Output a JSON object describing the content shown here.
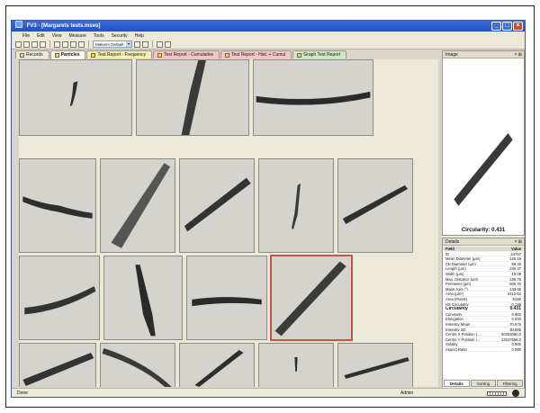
{
  "window": {
    "title": "FV3 - [Margarets tests.mses]",
    "controls": [
      "_",
      "□",
      "×"
    ]
  },
  "menu": [
    "File",
    "Edit",
    "View",
    "Measure",
    "Tools",
    "Security",
    "Help"
  ],
  "toolbar": {
    "profile_value": "Malvern Default",
    "icons": [
      "new-icon",
      "open-icon",
      "save-icon",
      "print-icon",
      "cut-icon",
      "copy-icon",
      "paste-icon",
      "undo-icon",
      "filter-icon",
      "play-icon",
      "back-icon",
      "forward-icon"
    ]
  },
  "tabs": [
    {
      "label": "Records",
      "style": "plain"
    },
    {
      "label": "Particles",
      "style": "active"
    },
    {
      "label": "Test Report - Frequency",
      "style": "yellow"
    },
    {
      "label": "Test Report - Cumulative",
      "style": "pink"
    },
    {
      "label": "Test Report - Hist. + Cumul",
      "style": "pink"
    },
    {
      "label": "Graph Test Report",
      "style": "green"
    }
  ],
  "image_panel": {
    "title": "Image",
    "caption": "Circularity: 0.431"
  },
  "details_panel": {
    "title": "Details",
    "header": {
      "field": "Field",
      "value": "Value"
    },
    "rows": [
      {
        "field": "ID",
        "value": "24757"
      },
      {
        "field": "Mean Diameter (µm)",
        "value": "126.19"
      },
      {
        "field": "CE Diameter (µm)",
        "value": "69.33"
      },
      {
        "field": "Length (µm)",
        "value": "230.37"
      },
      {
        "field": "Width (µm)",
        "value": "19.09"
      },
      {
        "field": "Max. Distance (µm)",
        "value": "236.76"
      },
      {
        "field": "Perimeter (µm)",
        "value": "505.70"
      },
      {
        "field": "Major Axis (°)",
        "value": "133.06"
      },
      {
        "field": "Area (µm²)",
        "value": "4412.53"
      },
      {
        "field": "Area (Pixels)",
        "value": "5159"
      },
      {
        "field": "HS Circularity",
        "value": "0.195"
      },
      {
        "field": "Circularity",
        "value": "0.431",
        "bold": true
      },
      {
        "field": "Convexity",
        "value": "0.982"
      },
      {
        "field": "Elongation",
        "value": "0.920"
      },
      {
        "field": "Intensity Mean",
        "value": "70.576"
      },
      {
        "field": "Intensity SD",
        "value": "30.886"
      },
      {
        "field": "Centre X Position (...",
        "value": "50303060.0"
      },
      {
        "field": "Centre Y Position (...",
        "value": "13247656.0"
      },
      {
        "field": "Solidity",
        "value": "0.906"
      },
      {
        "field": "Aspect Ratio",
        "value": "0.080"
      }
    ],
    "tabs": [
      "Details",
      "Sorting",
      "Filtering"
    ]
  },
  "status": {
    "left": "Done",
    "user": "Admin"
  }
}
